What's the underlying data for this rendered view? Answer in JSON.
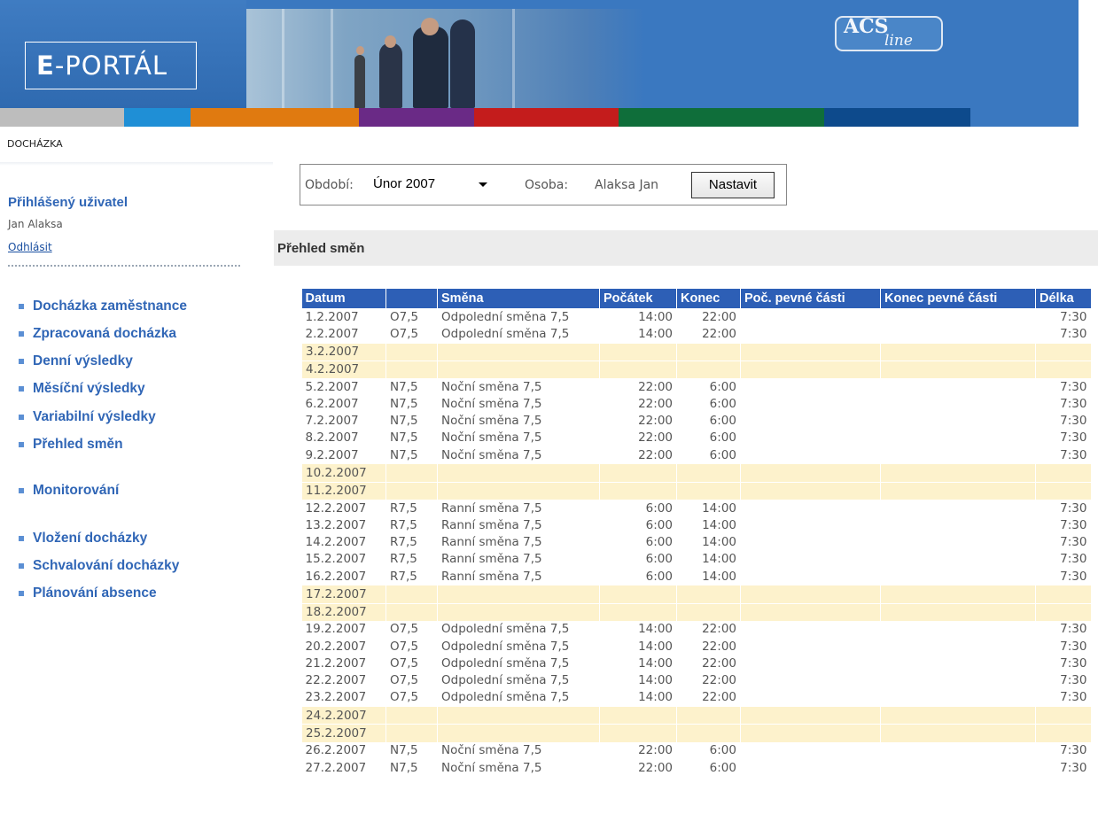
{
  "header": {
    "logo_text_bold": "E",
    "logo_text_rest": "-PORTÁL",
    "partner_logo_top": "ACS",
    "partner_logo_bottom": "line",
    "color_bar": [
      "#bdbdbd",
      "#1f8fd6",
      "#e07a10",
      "#6a2a86",
      "#c41c1c",
      "#0f6e3a",
      "#0d4a8c",
      "#3a78c0"
    ]
  },
  "breadcrumb": "DOCHÁZKA",
  "sidebar": {
    "user_heading": "Přihlášený uživatel",
    "user_name": "Jan Alaksa",
    "logout_label": "Odhlásit",
    "items": [
      {
        "label": "Docházka zaměstnance"
      },
      {
        "label": "Zpracovaná docházka"
      },
      {
        "label": "Denní výsledky"
      },
      {
        "label": "Měsíční výsledky"
      },
      {
        "label": "Variabilní výsledky"
      },
      {
        "label": "Přehled směn"
      },
      {
        "label": "Monitorování"
      },
      {
        "label": "Vložení docházky"
      },
      {
        "label": "Schvalování docházky"
      },
      {
        "label": "Plánování absence"
      }
    ]
  },
  "filter": {
    "period_label": "Období:",
    "period_value": "Únor 2007",
    "person_label": "Osoba:",
    "person_value": "Alaksa Jan",
    "set_button": "Nastavit"
  },
  "section_title": "Přehled směn",
  "table": {
    "columns": [
      "Datum",
      "",
      "Směna",
      "Počátek",
      "Konec",
      "Poč. pevné části",
      "Konec pevné části",
      "Délka"
    ],
    "rows": [
      {
        "date": "1.2.2007",
        "code": "O7,5",
        "shift": "Odpolední směna 7,5",
        "start": "14:00",
        "end": "22:00",
        "fixed_start": "",
        "fixed_end": "",
        "length": "7:30",
        "weekend": false
      },
      {
        "date": "2.2.2007",
        "code": "O7,5",
        "shift": "Odpolední směna 7,5",
        "start": "14:00",
        "end": "22:00",
        "fixed_start": "",
        "fixed_end": "",
        "length": "7:30",
        "weekend": false
      },
      {
        "date": "3.2.2007",
        "code": "",
        "shift": "",
        "start": "",
        "end": "",
        "fixed_start": "",
        "fixed_end": "",
        "length": "",
        "weekend": true
      },
      {
        "date": "4.2.2007",
        "code": "",
        "shift": "",
        "start": "",
        "end": "",
        "fixed_start": "",
        "fixed_end": "",
        "length": "",
        "weekend": true
      },
      {
        "date": "5.2.2007",
        "code": "N7,5",
        "shift": "Noční směna 7,5",
        "start": "22:00",
        "end": "6:00",
        "fixed_start": "",
        "fixed_end": "",
        "length": "7:30",
        "weekend": false
      },
      {
        "date": "6.2.2007",
        "code": "N7,5",
        "shift": "Noční směna 7,5",
        "start": "22:00",
        "end": "6:00",
        "fixed_start": "",
        "fixed_end": "",
        "length": "7:30",
        "weekend": false
      },
      {
        "date": "7.2.2007",
        "code": "N7,5",
        "shift": "Noční směna 7,5",
        "start": "22:00",
        "end": "6:00",
        "fixed_start": "",
        "fixed_end": "",
        "length": "7:30",
        "weekend": false
      },
      {
        "date": "8.2.2007",
        "code": "N7,5",
        "shift": "Noční směna 7,5",
        "start": "22:00",
        "end": "6:00",
        "fixed_start": "",
        "fixed_end": "",
        "length": "7:30",
        "weekend": false
      },
      {
        "date": "9.2.2007",
        "code": "N7,5",
        "shift": "Noční směna 7,5",
        "start": "22:00",
        "end": "6:00",
        "fixed_start": "",
        "fixed_end": "",
        "length": "7:30",
        "weekend": false
      },
      {
        "date": "10.2.2007",
        "code": "",
        "shift": "",
        "start": "",
        "end": "",
        "fixed_start": "",
        "fixed_end": "",
        "length": "",
        "weekend": true
      },
      {
        "date": "11.2.2007",
        "code": "",
        "shift": "",
        "start": "",
        "end": "",
        "fixed_start": "",
        "fixed_end": "",
        "length": "",
        "weekend": true
      },
      {
        "date": "12.2.2007",
        "code": "R7,5",
        "shift": "Ranní směna 7,5",
        "start": "6:00",
        "end": "14:00",
        "fixed_start": "",
        "fixed_end": "",
        "length": "7:30",
        "weekend": false
      },
      {
        "date": "13.2.2007",
        "code": "R7,5",
        "shift": "Ranní směna 7,5",
        "start": "6:00",
        "end": "14:00",
        "fixed_start": "",
        "fixed_end": "",
        "length": "7:30",
        "weekend": false
      },
      {
        "date": "14.2.2007",
        "code": "R7,5",
        "shift": "Ranní směna 7,5",
        "start": "6:00",
        "end": "14:00",
        "fixed_start": "",
        "fixed_end": "",
        "length": "7:30",
        "weekend": false
      },
      {
        "date": "15.2.2007",
        "code": "R7,5",
        "shift": "Ranní směna 7,5",
        "start": "6:00",
        "end": "14:00",
        "fixed_start": "",
        "fixed_end": "",
        "length": "7:30",
        "weekend": false
      },
      {
        "date": "16.2.2007",
        "code": "R7,5",
        "shift": "Ranní směna 7,5",
        "start": "6:00",
        "end": "14:00",
        "fixed_start": "",
        "fixed_end": "",
        "length": "7:30",
        "weekend": false
      },
      {
        "date": "17.2.2007",
        "code": "",
        "shift": "",
        "start": "",
        "end": "",
        "fixed_start": "",
        "fixed_end": "",
        "length": "",
        "weekend": true
      },
      {
        "date": "18.2.2007",
        "code": "",
        "shift": "",
        "start": "",
        "end": "",
        "fixed_start": "",
        "fixed_end": "",
        "length": "",
        "weekend": true
      },
      {
        "date": "19.2.2007",
        "code": "O7,5",
        "shift": "Odpolední směna 7,5",
        "start": "14:00",
        "end": "22:00",
        "fixed_start": "",
        "fixed_end": "",
        "length": "7:30",
        "weekend": false
      },
      {
        "date": "20.2.2007",
        "code": "O7,5",
        "shift": "Odpolední směna 7,5",
        "start": "14:00",
        "end": "22:00",
        "fixed_start": "",
        "fixed_end": "",
        "length": "7:30",
        "weekend": false
      },
      {
        "date": "21.2.2007",
        "code": "O7,5",
        "shift": "Odpolední směna 7,5",
        "start": "14:00",
        "end": "22:00",
        "fixed_start": "",
        "fixed_end": "",
        "length": "7:30",
        "weekend": false
      },
      {
        "date": "22.2.2007",
        "code": "O7,5",
        "shift": "Odpolední směna 7,5",
        "start": "14:00",
        "end": "22:00",
        "fixed_start": "",
        "fixed_end": "",
        "length": "7:30",
        "weekend": false
      },
      {
        "date": "23.2.2007",
        "code": "O7,5",
        "shift": "Odpolední směna 7,5",
        "start": "14:00",
        "end": "22:00",
        "fixed_start": "",
        "fixed_end": "",
        "length": "7:30",
        "weekend": false
      },
      {
        "date": "24.2.2007",
        "code": "",
        "shift": "",
        "start": "",
        "end": "",
        "fixed_start": "",
        "fixed_end": "",
        "length": "",
        "weekend": true
      },
      {
        "date": "25.2.2007",
        "code": "",
        "shift": "",
        "start": "",
        "end": "",
        "fixed_start": "",
        "fixed_end": "",
        "length": "",
        "weekend": true
      },
      {
        "date": "26.2.2007",
        "code": "N7,5",
        "shift": "Noční směna 7,5",
        "start": "22:00",
        "end": "6:00",
        "fixed_start": "",
        "fixed_end": "",
        "length": "7:30",
        "weekend": false
      },
      {
        "date": "27.2.2007",
        "code": "N7,5",
        "shift": "Noční směna 7,5",
        "start": "22:00",
        "end": "6:00",
        "fixed_start": "",
        "fixed_end": "",
        "length": "7:30",
        "weekend": false
      }
    ]
  }
}
